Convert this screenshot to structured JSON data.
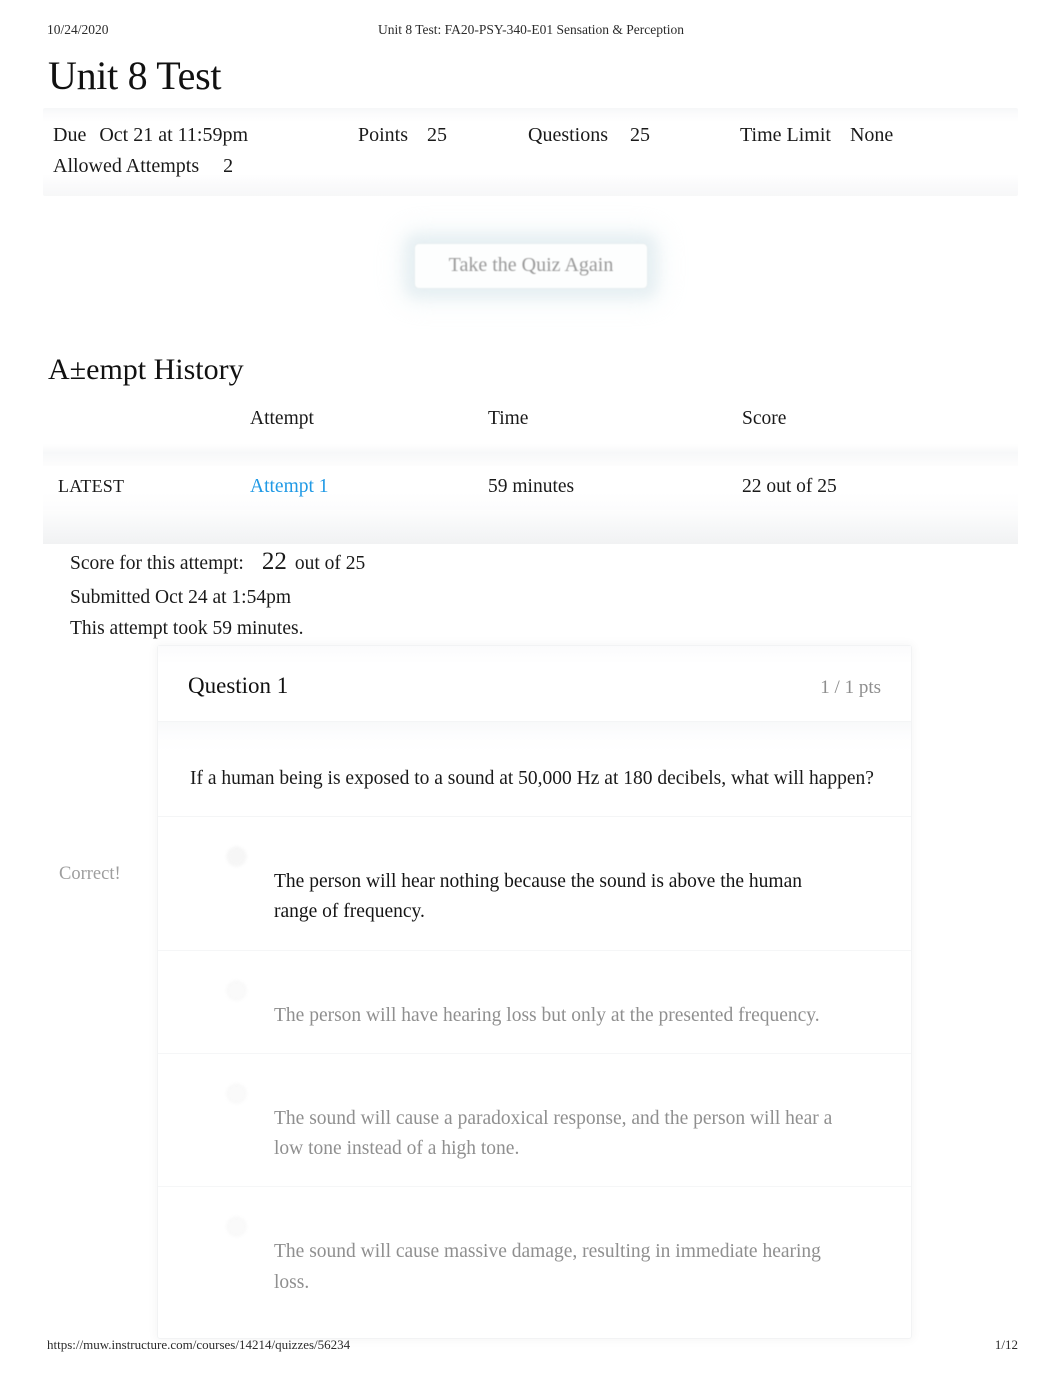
{
  "print_header": {
    "date": "10/24/2020",
    "document_title": "Unit 8 Test: FA20-PSY-340-E01 Sensation & Perception"
  },
  "page_title": "Unit 8 Test",
  "quiz_meta": {
    "due_label": "Due",
    "due_value": "Oct 21 at 11:59pm",
    "points_label": "Points",
    "points_value": "25",
    "questions_label": "Questions",
    "questions_value": "25",
    "time_limit_label": "Time Limit",
    "time_limit_value": "None",
    "allowed_attempts_label": "Allowed Attempts",
    "allowed_attempts_value": "2"
  },
  "actions": {
    "take_quiz_again": "Take the Quiz Again"
  },
  "attempt_history": {
    "section_title": "A±empt History",
    "columns": [
      "",
      "Attempt",
      "Time",
      "Score"
    ],
    "rows": [
      {
        "status": "LATEST",
        "attempt": "Attempt 1",
        "time": "59 minutes",
        "score": "22 out of 25"
      }
    ]
  },
  "attempt_summary": {
    "score_label": "Score for this attempt:",
    "score_value": "22",
    "score_outof": "out of 25",
    "submitted": "Submitted Oct 24 at 1:54pm",
    "duration": "This attempt took 59 minutes."
  },
  "question": {
    "number": "Question 1",
    "points": "1 / 1 pts",
    "prompt": "If a human being is exposed to a sound at 50,000 Hz at 180 decibels, what will happen?",
    "correct_marker": "Correct!",
    "answers": [
      {
        "text": "The person will hear nothing because the sound is above the human range of frequency.",
        "selected": true,
        "correct": true
      },
      {
        "text": "The person will have hearing loss but only at the presented frequency.",
        "selected": false,
        "correct": false
      },
      {
        "text": "The sound will cause a paradoxical response, and the person will hear a low tone instead of a high tone.",
        "selected": false,
        "correct": false
      },
      {
        "text": "The sound will cause massive damage, resulting in immediate hearing loss.",
        "selected": false,
        "correct": false
      }
    ]
  },
  "print_footer": {
    "url": "https://muw.instructure.com/courses/14214/quizzes/56234",
    "page_number": "1/12"
  },
  "colors": {
    "link": "#1f99e5",
    "muted_text": "#8f8f8f",
    "body_text": "#1a1a1a"
  }
}
